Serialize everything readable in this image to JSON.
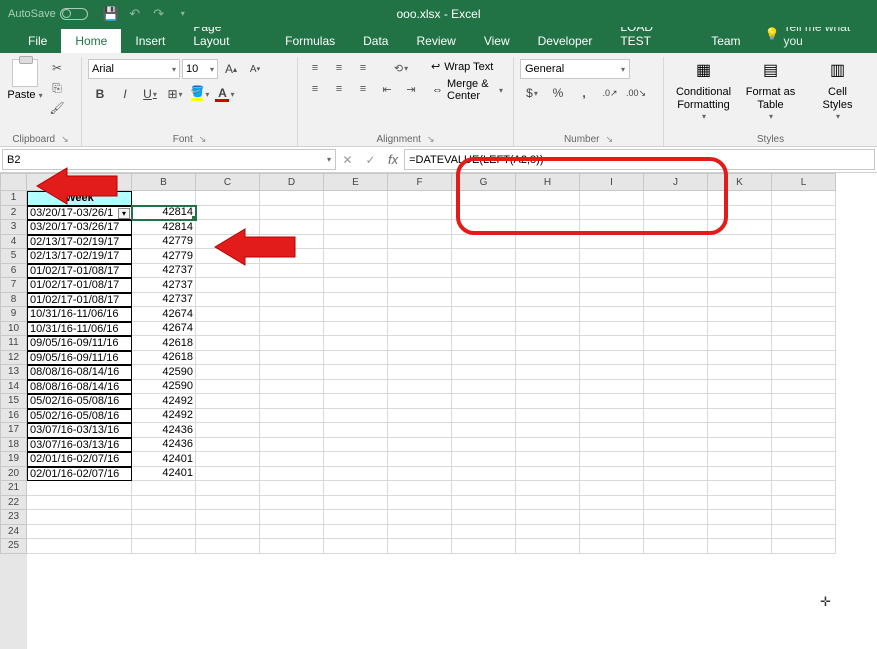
{
  "titlebar": {
    "autosave_label": "AutoSave",
    "autosave_state": "Off",
    "filename": "ooo.xlsx  -  Excel"
  },
  "tabs": {
    "file": "File",
    "home": "Home",
    "insert": "Insert",
    "pagelayout": "Page Layout",
    "formulas": "Formulas",
    "data": "Data",
    "review": "Review",
    "view": "View",
    "developer": "Developer",
    "loadtest": "LOAD TEST",
    "team": "Team",
    "tellme": "Tell me what you"
  },
  "ribbon": {
    "clipboard": {
      "paste": "Paste",
      "group": "Clipboard"
    },
    "font": {
      "name": "Arial",
      "size": "10",
      "group": "Font"
    },
    "alignment": {
      "wrap": "Wrap Text",
      "merge": "Merge & Center",
      "group": "Alignment"
    },
    "number": {
      "format": "General",
      "group": "Number"
    },
    "styles": {
      "cond": "Conditional\nFormatting",
      "fmt": "Format as\nTable",
      "cell": "Cell\nStyles",
      "group": "Styles"
    }
  },
  "namebox": "B2",
  "formula": "=DATEVALUE(LEFT(A2,8))",
  "columns": [
    "A",
    "B",
    "C",
    "D",
    "E",
    "F",
    "G",
    "H",
    "I",
    "J",
    "K",
    "L"
  ],
  "header_cell": "Week",
  "rows": [
    {
      "a": "03/20/17-03/26/1",
      "b": "42814",
      "filter": true
    },
    {
      "a": "03/20/17-03/26/17",
      "b": "42814"
    },
    {
      "a": "02/13/17-02/19/17",
      "b": "42779"
    },
    {
      "a": "02/13/17-02/19/17",
      "b": "42779"
    },
    {
      "a": "01/02/17-01/08/17",
      "b": "42737"
    },
    {
      "a": "01/02/17-01/08/17",
      "b": "42737"
    },
    {
      "a": "01/02/17-01/08/17",
      "b": "42737"
    },
    {
      "a": "10/31/16-11/06/16",
      "b": "42674"
    },
    {
      "a": "10/31/16-11/06/16",
      "b": "42674"
    },
    {
      "a": "09/05/16-09/11/16",
      "b": "42618"
    },
    {
      "a": "09/05/16-09/11/16",
      "b": "42618"
    },
    {
      "a": "08/08/16-08/14/16",
      "b": "42590"
    },
    {
      "a": "08/08/16-08/14/16",
      "b": "42590"
    },
    {
      "a": "05/02/16-05/08/16",
      "b": "42492"
    },
    {
      "a": "05/02/16-05/08/16",
      "b": "42492"
    },
    {
      "a": "03/07/16-03/13/16",
      "b": "42436"
    },
    {
      "a": "03/07/16-03/13/16",
      "b": "42436"
    },
    {
      "a": "02/01/16-02/07/16",
      "b": "42401"
    },
    {
      "a": "02/01/16-02/07/16",
      "b": "42401"
    }
  ],
  "empty_rows": 5
}
